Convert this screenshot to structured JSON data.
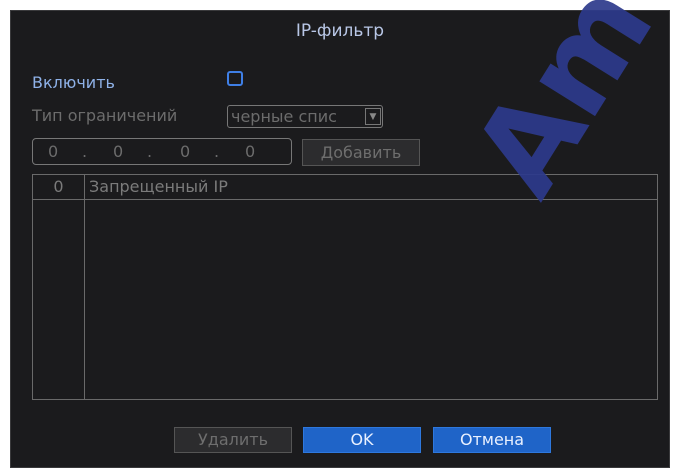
{
  "dialog": {
    "title": "IP-фильтр",
    "enable_label": "Включить",
    "enable_checked": false,
    "restriction_label": "Тип ограничений",
    "restriction_value": "черные спис",
    "ip": {
      "octets": [
        "0",
        "0",
        "0",
        "0"
      ],
      "separator": "."
    },
    "add_button": "Добавить",
    "table": {
      "headers": [
        "0",
        "Запрещенный IP"
      ],
      "rows": []
    },
    "buttons": {
      "delete": "Удалить",
      "ok": "OK",
      "cancel": "Отмена"
    }
  },
  "watermark": "Am",
  "colors": {
    "background": "#1b1b1d",
    "accent": "#1f64c8",
    "checkbox": "#3f7fe6",
    "title": "#b9c7e6",
    "watermark": "#2d3a8c"
  }
}
